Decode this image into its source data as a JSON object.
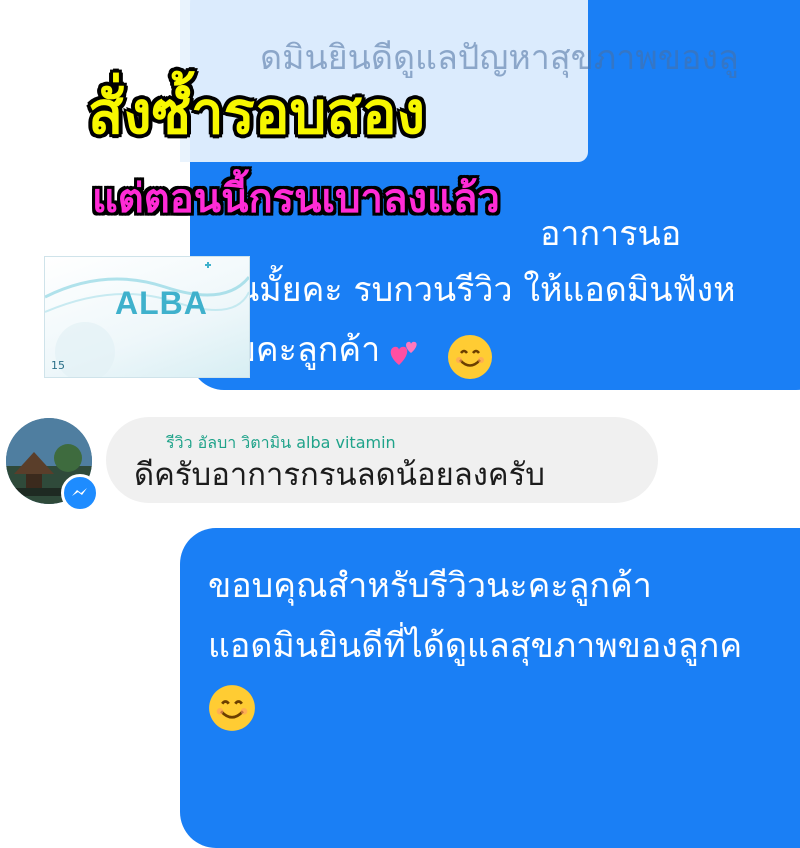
{
  "headline": {
    "line1": "สั่งซ้ำรอบสอง",
    "line2": "แต่ตอนนี้กรนเบาลงแล้ว"
  },
  "product": {
    "brand": "ALBA",
    "count": "15"
  },
  "top_bubble": {
    "faded_line": "ดมินยินดีดูแลปัญหาสุขภาพของลู",
    "line_partial": "อาการนอ",
    "line2": "นมั้ยคะ รบกวนรีวิว ให้แอดมินฟังห",
    "line3": "ยคะลูกค้า"
  },
  "incoming_message": {
    "review_label": "รีวิว อัลบา วิตามิน alba vitamin",
    "text": "ดีครับอาการกรนลดน้อยลงครับ"
  },
  "reply_bubble": {
    "line1": "ขอบคุณสำหรับรีวิวนะคะลูกค้า",
    "line2": "แอดมินยินดีที่ได้ดูแลสุขภาพของลูกค"
  },
  "colors": {
    "bubble_blue": "#1a7ff5",
    "headline_yellow": "#f7f700",
    "headline_pink": "#ff2bd6",
    "review_green": "#1fa38a"
  },
  "icons": [
    "smile-emoji-icon",
    "two-hearts-emoji-icon",
    "messenger-badge-icon"
  ]
}
